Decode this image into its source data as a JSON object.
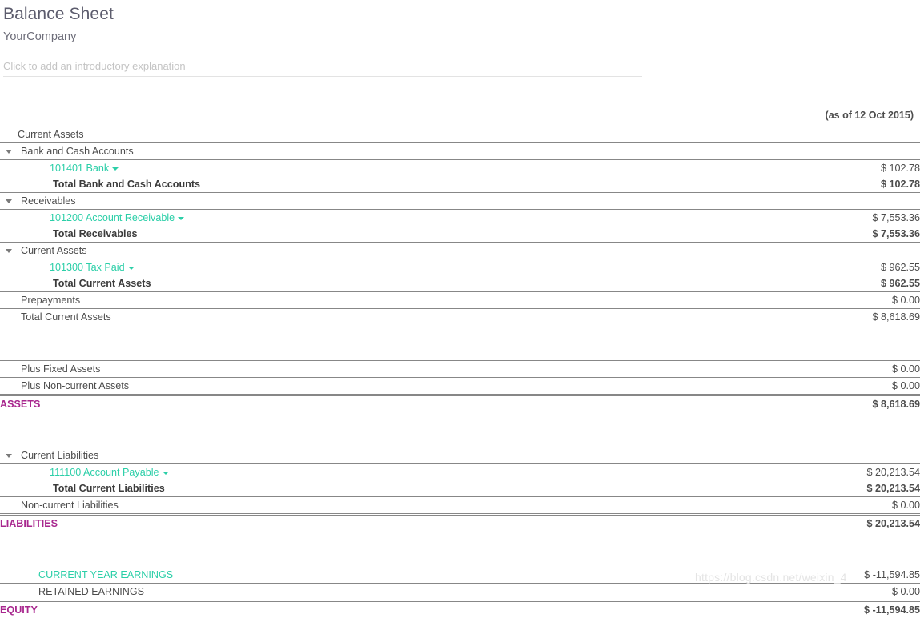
{
  "document": {
    "title": "Balance Sheet",
    "company": "YourCompany",
    "intro_placeholder": "Click to add an introductory explanation",
    "as_of": "(as of 12 Oct 2015)"
  },
  "colors": {
    "link_teal": "#2ccfa8",
    "grand_total": "#a8278e",
    "text": "#4c4c4c",
    "rule": "#878787"
  },
  "rows": [
    {
      "id": "current-assets-header",
      "label": "Current Assets",
      "amount": "",
      "indent": "lvl0",
      "caret": false,
      "bold": false,
      "link": false,
      "border": "none",
      "style": "plain"
    },
    {
      "id": "bank-and-cash-accounts",
      "label": "Bank and Cash Accounts",
      "amount": "",
      "indent": "lvl1",
      "caret": true,
      "bold": false,
      "link": false,
      "border": "bt",
      "style": "plain"
    },
    {
      "id": "acct-101401-bank",
      "label": "101401 Bank",
      "amount": "$ 102.78",
      "indent": "lvl2",
      "caret": false,
      "bold": false,
      "link": true,
      "border": "bt",
      "style": "link"
    },
    {
      "id": "total-bank-and-cash",
      "label": "Total Bank and Cash Accounts",
      "amount": "$ 102.78",
      "indent": "lvl2b",
      "caret": false,
      "bold": true,
      "link": false,
      "border": "none",
      "style": "bold"
    },
    {
      "id": "receivables",
      "label": "Receivables",
      "amount": "",
      "indent": "lvl1",
      "caret": true,
      "bold": false,
      "link": false,
      "border": "bt",
      "style": "plain"
    },
    {
      "id": "acct-101200-receivable",
      "label": "101200 Account Receivable",
      "amount": "$ 7,553.36",
      "indent": "lvl2",
      "caret": false,
      "bold": false,
      "link": true,
      "border": "bt",
      "style": "link"
    },
    {
      "id": "total-receivables",
      "label": "Total Receivables",
      "amount": "$ 7,553.36",
      "indent": "lvl2b",
      "caret": false,
      "bold": true,
      "link": false,
      "border": "none",
      "style": "bold"
    },
    {
      "id": "current-assets-group",
      "label": "Current Assets",
      "amount": "",
      "indent": "lvl1",
      "caret": true,
      "bold": false,
      "link": false,
      "border": "bt",
      "style": "plain"
    },
    {
      "id": "acct-101300-tax-paid",
      "label": "101300 Tax Paid",
      "amount": "$ 962.55",
      "indent": "lvl2",
      "caret": false,
      "bold": false,
      "link": true,
      "border": "bt",
      "style": "link"
    },
    {
      "id": "total-current-assets-sub",
      "label": "Total Current Assets",
      "amount": "$ 962.55",
      "indent": "lvl2b",
      "caret": false,
      "bold": true,
      "link": false,
      "border": "none",
      "style": "bold"
    },
    {
      "id": "prepayments",
      "label": "Prepayments",
      "amount": "$ 0.00",
      "indent": "lvl1",
      "caret": false,
      "bold": false,
      "link": false,
      "border": "bt",
      "style": "plain"
    },
    {
      "id": "total-current-assets",
      "label": "Total Current Assets",
      "amount": "$ 8,618.69",
      "indent": "lvl1",
      "caret": false,
      "bold": false,
      "link": false,
      "border": "bt",
      "style": "plain"
    }
  ],
  "rows_fixed": [
    {
      "id": "plus-fixed-assets",
      "label": "Plus Fixed Assets",
      "amount": "$ 0.00",
      "indent": "lvl1",
      "caret": false,
      "bold": false,
      "link": false,
      "border": "bt",
      "style": "plain"
    },
    {
      "id": "plus-non-current-assets",
      "label": "Plus Non-current Assets",
      "amount": "$ 0.00",
      "indent": "lvl1",
      "caret": false,
      "bold": false,
      "link": false,
      "border": "bt",
      "style": "plain"
    }
  ],
  "assets_total": {
    "id": "assets-total",
    "label": "ASSETS",
    "amount": "$ 8,618.69"
  },
  "rows_liabilities": [
    {
      "id": "current-liabilities",
      "label": "Current Liabilities",
      "amount": "",
      "indent": "lvl1",
      "caret": true,
      "bold": false,
      "link": false,
      "border": "none",
      "style": "plain"
    },
    {
      "id": "acct-111100-payable",
      "label": "111100 Account Payable",
      "amount": "$ 20,213.54",
      "indent": "lvl2",
      "caret": false,
      "bold": false,
      "link": true,
      "border": "bt",
      "style": "link"
    },
    {
      "id": "total-current-liabilities",
      "label": "Total Current Liabilities",
      "amount": "$ 20,213.54",
      "indent": "lvl2b",
      "caret": false,
      "bold": true,
      "link": false,
      "border": "none",
      "style": "bold"
    },
    {
      "id": "non-current-liabilities",
      "label": "Non-current Liabilities",
      "amount": "$ 0.00",
      "indent": "lvl1",
      "caret": false,
      "bold": false,
      "link": false,
      "border": "bt",
      "style": "plain"
    }
  ],
  "liabilities_total": {
    "id": "liabilities-total",
    "label": "LIABILITIES",
    "amount": "$ 20,213.54"
  },
  "rows_equity": [
    {
      "id": "current-year-earnings",
      "label": "CURRENT YEAR EARNINGS",
      "amount": "$ -11,594.85",
      "indent": "lvl1b",
      "caret": false,
      "bold": false,
      "link": true,
      "border": "none",
      "style": "link-plain"
    },
    {
      "id": "retained-earnings",
      "label": "RETAINED EARNINGS",
      "amount": "$ 0.00",
      "indent": "lvl1b",
      "caret": false,
      "bold": false,
      "link": false,
      "border": "bt",
      "style": "plain"
    }
  ],
  "equity_total": {
    "id": "equity-total",
    "label": "EQUITY",
    "amount": "$ -11,594.85"
  },
  "watermark": "https://blog.csdn.net/weixin_4"
}
